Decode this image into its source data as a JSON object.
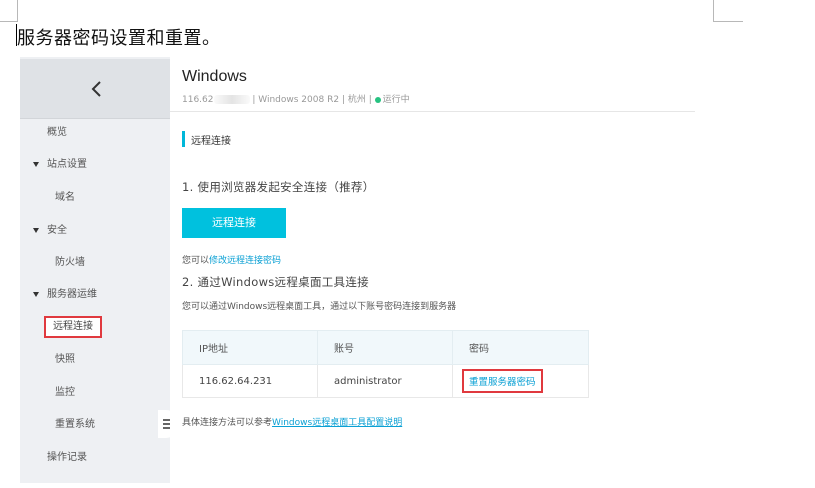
{
  "document": {
    "title": "服务器密码设置和重置。"
  },
  "sidebar": {
    "back_icon": "chevron-left-icon",
    "items": [
      {
        "label": "概览",
        "type": "item"
      },
      {
        "label": "站点设置",
        "type": "group"
      },
      {
        "label": "域名",
        "type": "subitem"
      },
      {
        "label": "安全",
        "type": "group"
      },
      {
        "label": "防火墙",
        "type": "subitem"
      },
      {
        "label": "服务器运维",
        "type": "group"
      },
      {
        "label": "远程连接",
        "type": "subitem",
        "active": true
      },
      {
        "label": "快照",
        "type": "subitem"
      },
      {
        "label": "监控",
        "type": "subitem"
      },
      {
        "label": "重置系统",
        "type": "subitem"
      },
      {
        "label": "操作记录",
        "type": "item"
      }
    ],
    "collapse_icon": "list-collapse-icon"
  },
  "header": {
    "os_name": "Windows",
    "ip_prefix": "116.62",
    "os_version": "| Windows 2008 R2 |",
    "region": "杭州",
    "separator": "|",
    "status": "运行中",
    "status_color": "#26c281"
  },
  "main": {
    "section_title": "远程连接",
    "step1_title": "1. 使用浏览器发起安全连接（推荐）",
    "connect_button": "远程连接",
    "change_pass_prefix": "您可以",
    "change_pass_link": "修改远程连接密码",
    "step2_title": "2. 通过Windows远程桌面工具连接",
    "step2_desc": "您可以通过Windows远程桌面工具，通过以下账号密码连接到服务器",
    "table": {
      "headers": [
        "IP地址",
        "账号",
        "密码"
      ],
      "rows": [
        {
          "ip": "116.62.64.231",
          "account": "administrator",
          "password_link": "重置服务器密码"
        }
      ]
    },
    "footnote_prefix": "具体连接方法可以参考",
    "footnote_link": "Windows远程桌面工具配置说明"
  },
  "colors": {
    "accent": "#00c1de",
    "link": "#0aa0d4",
    "highlight_box": "#e0393e"
  }
}
